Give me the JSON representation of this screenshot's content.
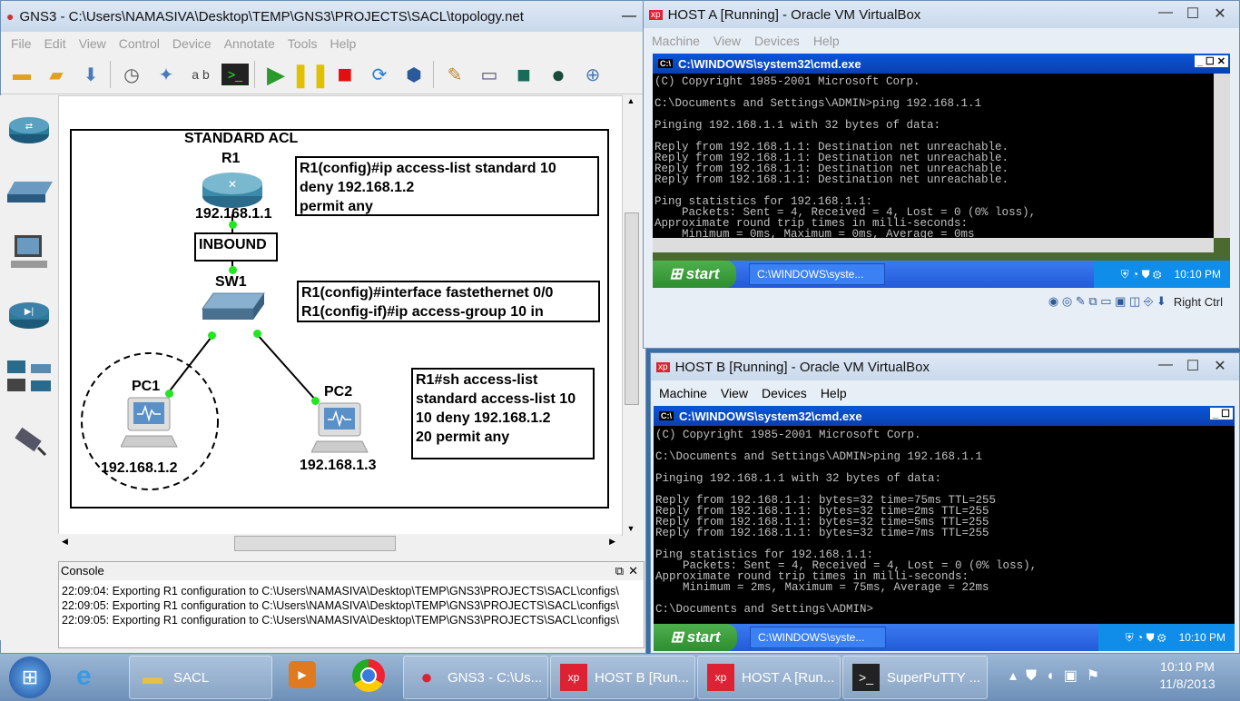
{
  "gns3": {
    "title": "GNS3 - C:\\Users\\NAMASIVA\\Desktop\\TEMP\\GNS3\\PROJECTS\\SACL\\topology.net",
    "menu": [
      "File",
      "Edit",
      "View",
      "Control",
      "Device",
      "Annotate",
      "Tools",
      "Help"
    ],
    "topology": {
      "title": "STANDARD ACL",
      "r1_label": "R1",
      "r1_ip": "192.168.1.1",
      "inbound": "INBOUND",
      "sw1_label": "SW1",
      "pc1_label": "PC1",
      "pc1_ip": "192.168.1.2",
      "pc2_label": "PC2",
      "pc2_ip": "192.168.1.3",
      "note1": "R1(config)#ip access-list standard 10\ndeny 192.168.1.2\npermit any",
      "note2": "R1(config)#interface fastethernet 0/0\nR1(config-if)#ip access-group 10 in",
      "note3": "R1#sh access-list\nstandard access-list 10\n10 deny 192.168.1.2\n20 permit any"
    },
    "console": {
      "title": "Console",
      "lines": [
        "22:09:04: Exporting R1 configuration to C:\\Users\\NAMASIVA\\Desktop\\TEMP\\GNS3\\PROJECTS\\SACL\\configs\\",
        "22:09:05: Exporting R1 configuration to C:\\Users\\NAMASIVA\\Desktop\\TEMP\\GNS3\\PROJECTS\\SACL\\configs\\",
        "22:09:05: Exporting R1 configuration to C:\\Users\\NAMASIVA\\Desktop\\TEMP\\GNS3\\PROJECTS\\SACL\\configs\\"
      ]
    }
  },
  "hostA": {
    "title": "HOST A [Running] - Oracle VM VirtualBox",
    "menu": [
      "Machine",
      "View",
      "Devices",
      "Help"
    ],
    "cmd_title": "C:\\WINDOWS\\system32\\cmd.exe",
    "cmd_text": "(C) Copyright 1985-2001 Microsoft Corp.\n\nC:\\Documents and Settings\\ADMIN>ping 192.168.1.1\n\nPinging 192.168.1.1 with 32 bytes of data:\n\nReply from 192.168.1.1: Destination net unreachable.\nReply from 192.168.1.1: Destination net unreachable.\nReply from 192.168.1.1: Destination net unreachable.\nReply from 192.168.1.1: Destination net unreachable.\n\nPing statistics for 192.168.1.1:\n    Packets: Sent = 4, Received = 4, Lost = 0 (0% loss),\nApproximate round trip times in milli-seconds:\n    Minimum = 0ms, Maximum = 0ms, Average = 0ms",
    "start": "start",
    "task_item": "C:\\WINDOWS\\syste...",
    "clock": "10:10 PM",
    "host_key": "Right Ctrl"
  },
  "hostB": {
    "title": "HOST B [Running] - Oracle VM VirtualBox",
    "menu": [
      "Machine",
      "View",
      "Devices",
      "Help"
    ],
    "cmd_title": "C:\\WINDOWS\\system32\\cmd.exe",
    "cmd_text": "(C) Copyright 1985-2001 Microsoft Corp.\n\nC:\\Documents and Settings\\ADMIN>ping 192.168.1.1\n\nPinging 192.168.1.1 with 32 bytes of data:\n\nReply from 192.168.1.1: bytes=32 time=75ms TTL=255\nReply from 192.168.1.1: bytes=32 time=2ms TTL=255\nReply from 192.168.1.1: bytes=32 time=5ms TTL=255\nReply from 192.168.1.1: bytes=32 time=7ms TTL=255\n\nPing statistics for 192.168.1.1:\n    Packets: Sent = 4, Received = 4, Lost = 0 (0% loss),\nApproximate round trip times in milli-seconds:\n    Minimum = 2ms, Maximum = 75ms, Average = 22ms\n\nC:\\Documents and Settings\\ADMIN>",
    "start": "start",
    "task_item": "C:\\WINDOWS\\syste...",
    "clock": "10:10 PM"
  },
  "taskbar": {
    "items": [
      "SACL",
      "GNS3 - C:\\Us...",
      "HOST B [Run...",
      "HOST A [Run...",
      "SuperPuTTY ..."
    ],
    "time": "10:10 PM",
    "date": "11/8/2013"
  }
}
